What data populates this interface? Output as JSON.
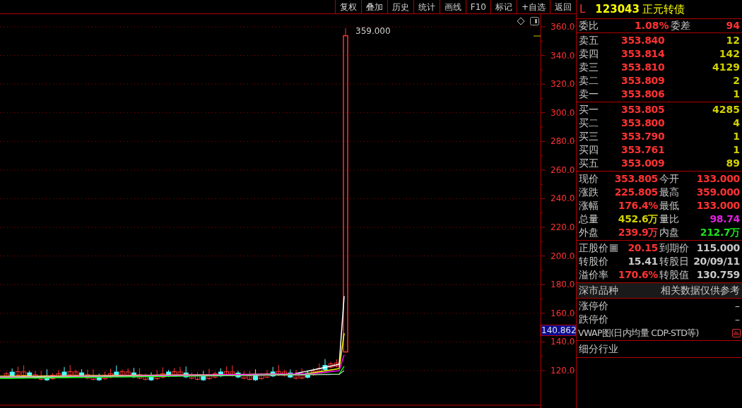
{
  "toolbar": [
    "复权",
    "叠加",
    "历史",
    "统计",
    "画线",
    "F10",
    "标记",
    "+自选",
    "返回"
  ],
  "chart": {
    "y_axis_labels": [
      "360.0",
      "340.0",
      "320.0",
      "300.0",
      "280.0",
      "260.0",
      "240.0",
      "220.0",
      "200.0",
      "180.0",
      "160.0",
      "140.0",
      "120.0"
    ],
    "high_marker": "359.000",
    "current_price_tag": "140.862"
  },
  "quote": {
    "market_flag": "L",
    "code": "123043",
    "name": "正元转债"
  },
  "order_ratio": {
    "label": "委比",
    "value": "1.08%",
    "diff_label": "委差",
    "diff": "94"
  },
  "asks": [
    {
      "label": "卖五",
      "price": "353.840",
      "volume": "12"
    },
    {
      "label": "卖四",
      "price": "353.814",
      "volume": "142"
    },
    {
      "label": "卖三",
      "price": "353.810",
      "volume": "4129"
    },
    {
      "label": "卖二",
      "price": "353.809",
      "volume": "2"
    },
    {
      "label": "卖一",
      "price": "353.806",
      "volume": "1"
    }
  ],
  "bids": [
    {
      "label": "买一",
      "price": "353.805",
      "volume": "4285"
    },
    {
      "label": "买二",
      "price": "353.800",
      "volume": "4"
    },
    {
      "label": "买三",
      "price": "353.790",
      "volume": "1"
    },
    {
      "label": "买四",
      "price": "353.761",
      "volume": "1"
    },
    {
      "label": "买五",
      "price": "353.009",
      "volume": "89"
    }
  ],
  "stats": [
    {
      "cells": [
        {
          "label": "现价",
          "value": "353.805",
          "color": "#ff3232"
        },
        {
          "label": "今开",
          "value": "133.000",
          "color": "#ff3232"
        }
      ]
    },
    {
      "cells": [
        {
          "label": "涨跌",
          "value": "225.805",
          "color": "#ff3232"
        },
        {
          "label": "最高",
          "value": "359.000",
          "color": "#ff3232"
        }
      ]
    },
    {
      "cells": [
        {
          "label": "涨幅",
          "value": "176.4%",
          "color": "#ff3232"
        },
        {
          "label": "最低",
          "value": "133.000",
          "color": "#ff3232"
        }
      ]
    },
    {
      "cells": [
        {
          "label": "总量",
          "value": "452.6万",
          "color": "#d2d200"
        },
        {
          "label": "量比",
          "value": "98.74",
          "color": "#e020e0"
        }
      ]
    },
    {
      "cells": [
        {
          "label": "外盘",
          "value": "239.9万",
          "color": "#ff3232"
        },
        {
          "label": "内盘",
          "value": "212.7万",
          "color": "#20e020"
        }
      ]
    }
  ],
  "bond": [
    {
      "cells": [
        {
          "kind": "label_with_icon",
          "label": "正股价",
          "value": "20.15",
          "color": "#ff3232"
        },
        {
          "kind": "label",
          "label": "到期价",
          "value": "115.000",
          "color": "#c8c8c8"
        }
      ]
    },
    {
      "cells": [
        {
          "kind": "label",
          "label": "转股价",
          "value": "15.41",
          "color": "#c8c8c8"
        },
        {
          "kind": "label",
          "label": "转股日",
          "value": "20/09/11",
          "color": "#c8c8c8"
        }
      ]
    },
    {
      "cells": [
        {
          "kind": "label",
          "label": "溢价率",
          "value": "170.6%",
          "color": "#ff3232"
        },
        {
          "kind": "label",
          "label": "转股值",
          "value": "130.759",
          "color": "#c8c8c8"
        }
      ]
    }
  ],
  "market": {
    "label": "深市品种",
    "note": "相关数据仅供参考"
  },
  "limits": [
    {
      "label": "涨停价",
      "value": "–"
    },
    {
      "label": "跌停价",
      "value": "–"
    }
  ],
  "vwap": "VWAP图(日内均量 CDP-STD等)",
  "industry": "细分行业"
}
